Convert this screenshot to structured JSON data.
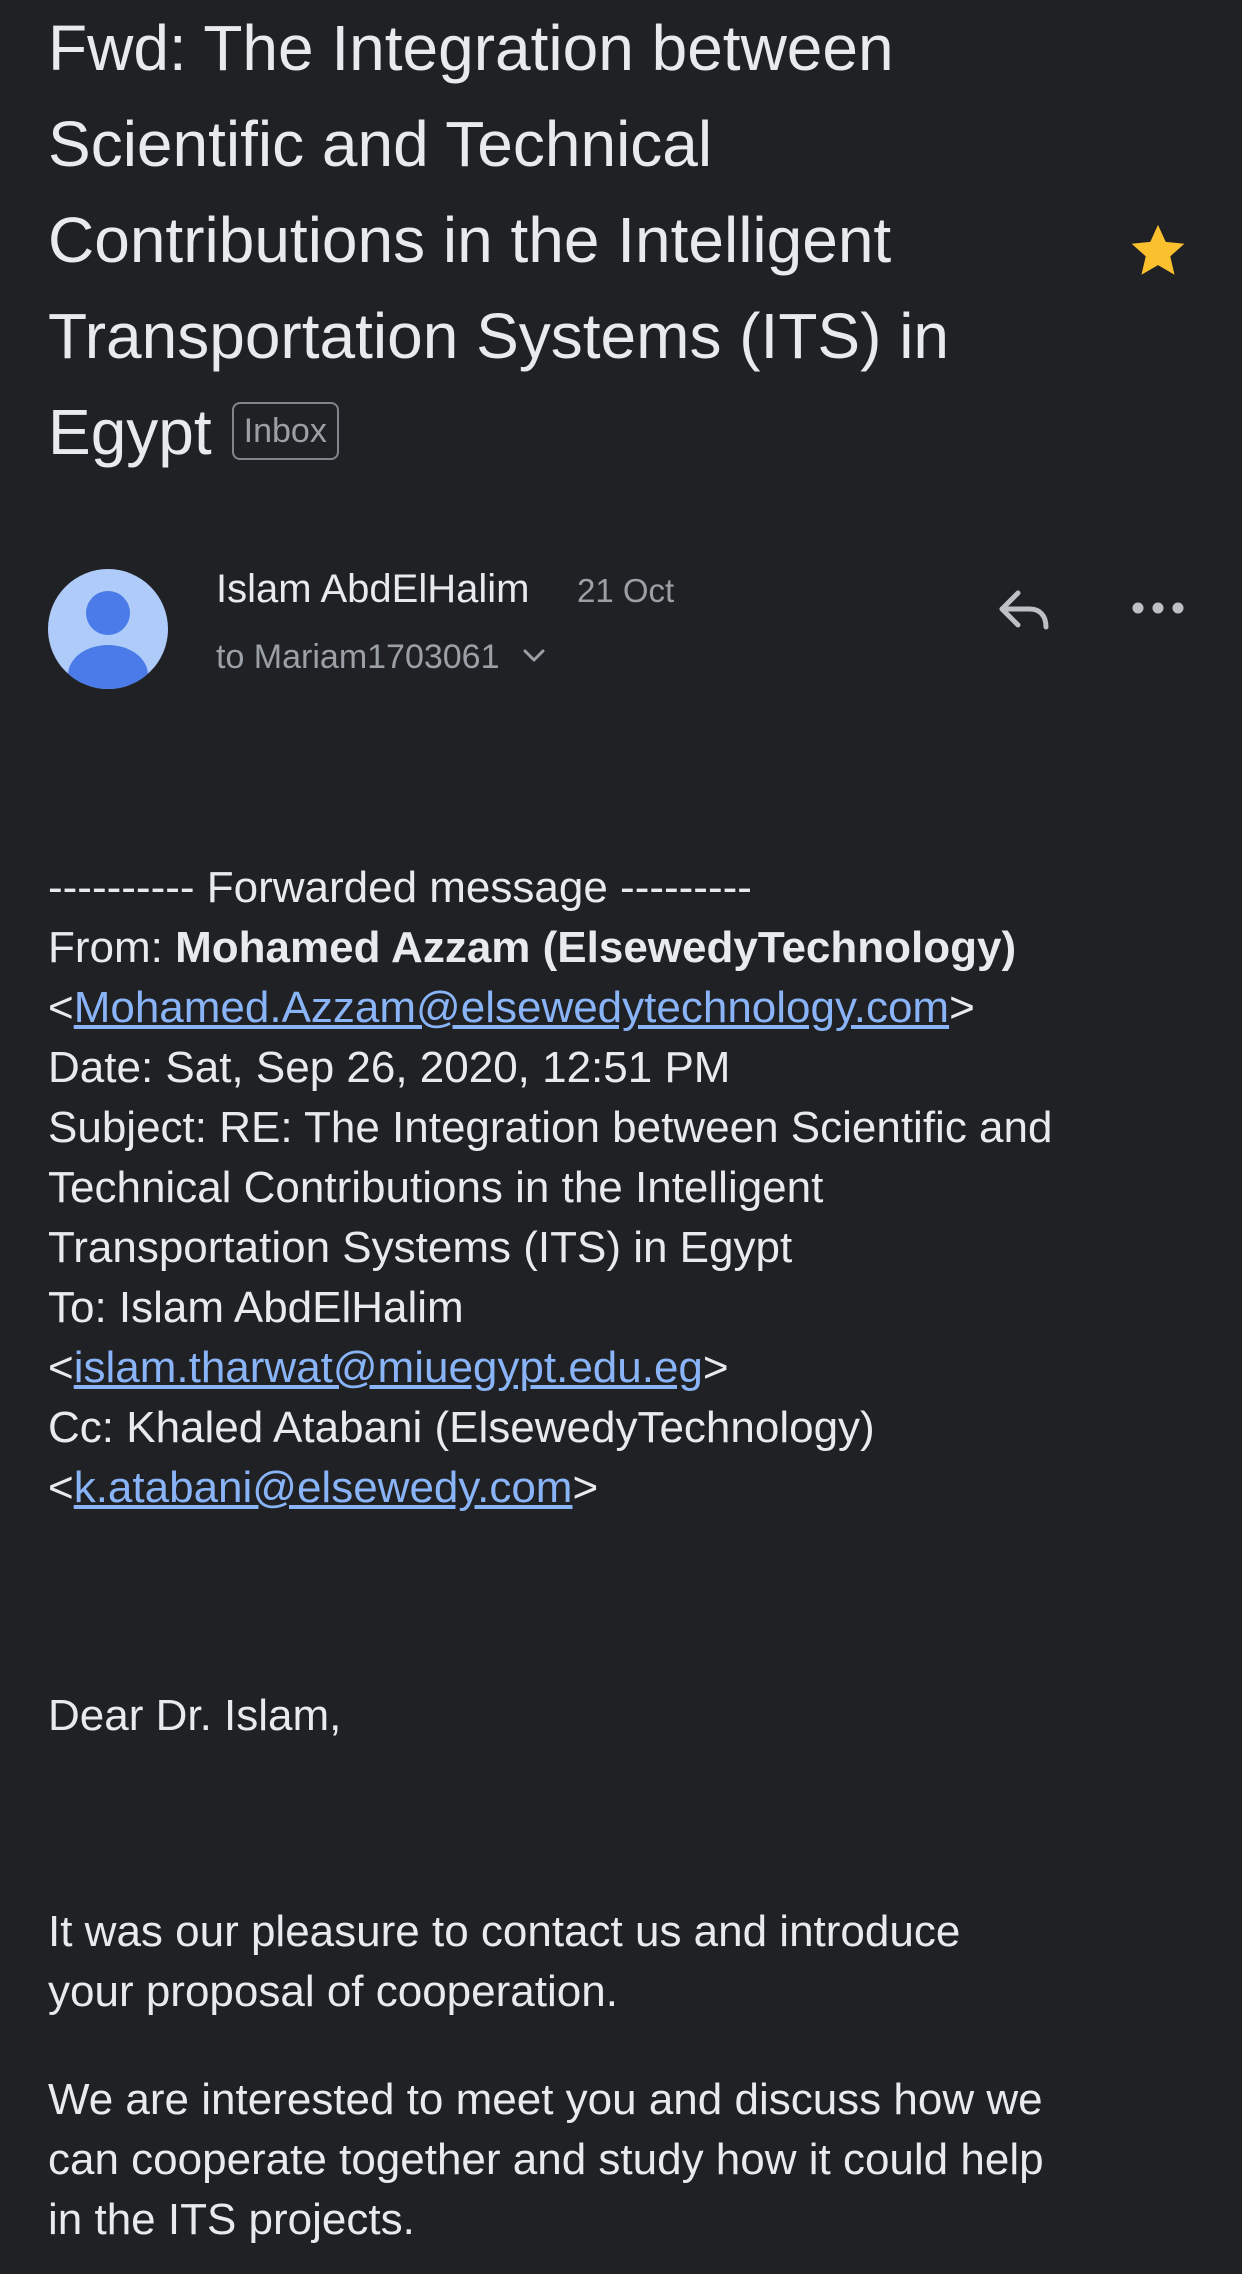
{
  "email": {
    "subject": "Fwd: The Integration between Scientific and Technical Contributions in the Intelligent Transportation Systems (ITS) in Egypt",
    "subject_lines": [
      "Fwd: The Integration between",
      "Scientific and Technical",
      "Contributions in the Intelligent",
      "Transportation Systems (ITS) in",
      "Egypt"
    ],
    "label": "Inbox",
    "starred": true
  },
  "sender": {
    "name": "Islam AbdElHalim",
    "date": "21 Oct",
    "recipient": "to Mariam1703061"
  },
  "forwarded": {
    "header": "---------- Forwarded message ---------",
    "from_label": "From: ",
    "from_name": "Mohamed Azzam (ElsewedyTechnology)",
    "from_email": "Mohamed.Azzam@elsewedytechnology.com",
    "date_line": "Date: Sat, Sep 26, 2020, 12:51 PM",
    "subject_lines": [
      "Subject: RE: The Integration between Scientific and",
      "Technical Contributions in the Intelligent",
      "Transportation Systems (ITS) in Egypt"
    ],
    "to_line": "To: Islam AbdElHalim",
    "to_email": "islam.tharwat@miuegypt.edu.eg",
    "cc_line": "Cc: Khaled Atabani (ElsewedyTechnology)",
    "cc_email": "k.atabani@elsewedy.com"
  },
  "message": {
    "greeting": "Dear Dr. Islam,",
    "paragraph1_lines": [
      "It was our pleasure to contact us and introduce",
      "your proposal of cooperation."
    ],
    "paragraph2_lines": [
      "We are interested to meet you and discuss how we",
      "can cooperate together and study how it could help",
      "in the ITS projects."
    ]
  },
  "colors": {
    "background": "#202124",
    "text": "#e8eaed",
    "muted": "#9aa0a6",
    "link": "#8ab4f8",
    "star": "#fbc02d",
    "avatar_bg": "#aecbfa",
    "avatar_fg": "#4a7be8"
  },
  "icons": {
    "star": "star-icon",
    "reply": "reply-icon",
    "more": "more-options-icon",
    "expand": "chevron-down-icon",
    "avatar": "person-icon"
  }
}
